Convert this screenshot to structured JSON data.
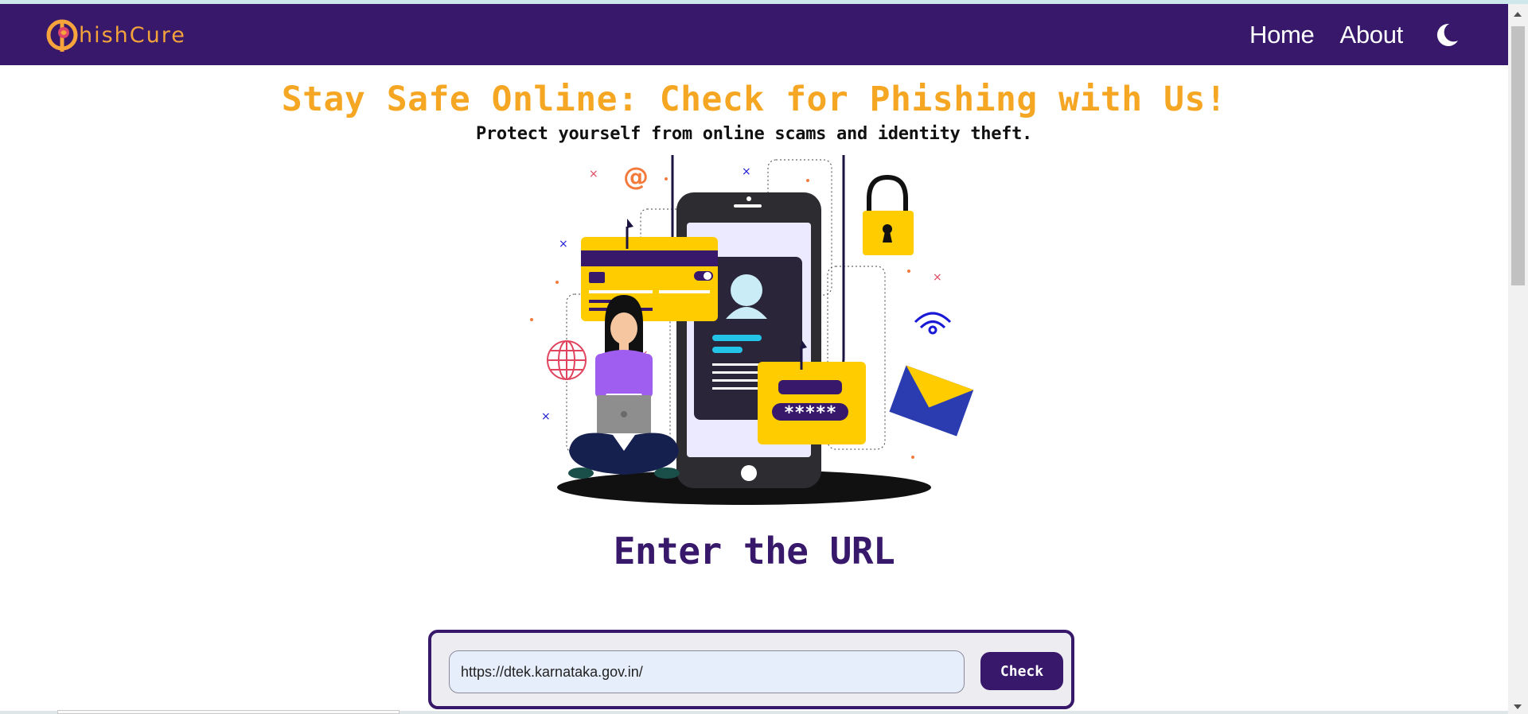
{
  "app": {
    "logo_text": "hishCure"
  },
  "nav": {
    "items": [
      {
        "label": "Home"
      },
      {
        "label": "About"
      }
    ],
    "theme_toggle_icon": "moon-icon"
  },
  "hero": {
    "title": "Stay Safe Online: Check for Phishing with Us!",
    "subtitle": "Protect yourself from online scams and identity theft."
  },
  "illustration": {
    "password_mask": "*****",
    "at_symbol": "@"
  },
  "check": {
    "heading": "Enter the URL",
    "input_value": "https://dtek.karnataka.gov.in/",
    "button_label": "Check"
  },
  "colors": {
    "brand_purple": "#37186a",
    "accent_orange": "#f5a623",
    "card_yellow": "#ffcc00"
  }
}
